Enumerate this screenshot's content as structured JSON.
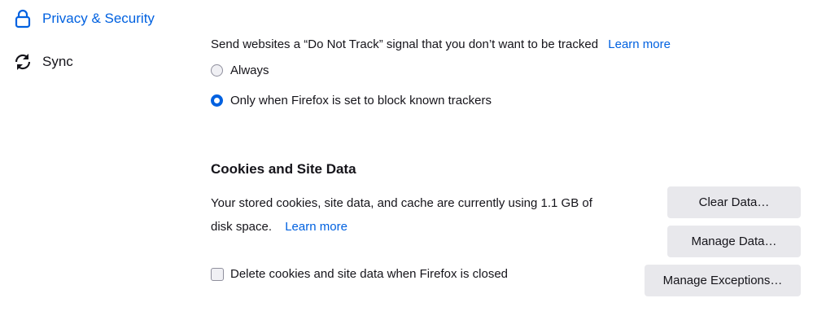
{
  "sidebar": {
    "items": [
      {
        "label": "Privacy & Security",
        "icon": "lock-icon",
        "selected": true
      },
      {
        "label": "Sync",
        "icon": "sync-icon",
        "selected": false
      }
    ]
  },
  "dnt": {
    "description": "Send websites a “Do Not Track” signal that you don’t want to be tracked",
    "learn_more": "Learn more",
    "options": [
      {
        "label": "Always",
        "checked": false
      },
      {
        "label": "Only when Firefox is set to block known trackers",
        "checked": true
      }
    ]
  },
  "cookies": {
    "heading": "Cookies and Site Data",
    "usage_line1": "Your stored cookies, site data, and cache are currently using 1.1 GB of",
    "usage_line2": "disk space.",
    "learn_more": "Learn more",
    "delete_on_close": {
      "label": "Delete cookies and site data when Firefox is closed",
      "checked": false
    },
    "buttons": {
      "clear": "Clear Data…",
      "manage": "Manage Data…",
      "exceptions": "Manage Exceptions…"
    }
  },
  "colors": {
    "accent": "#0061e0",
    "button_bg": "#e8e8ec",
    "text": "#15141a"
  }
}
